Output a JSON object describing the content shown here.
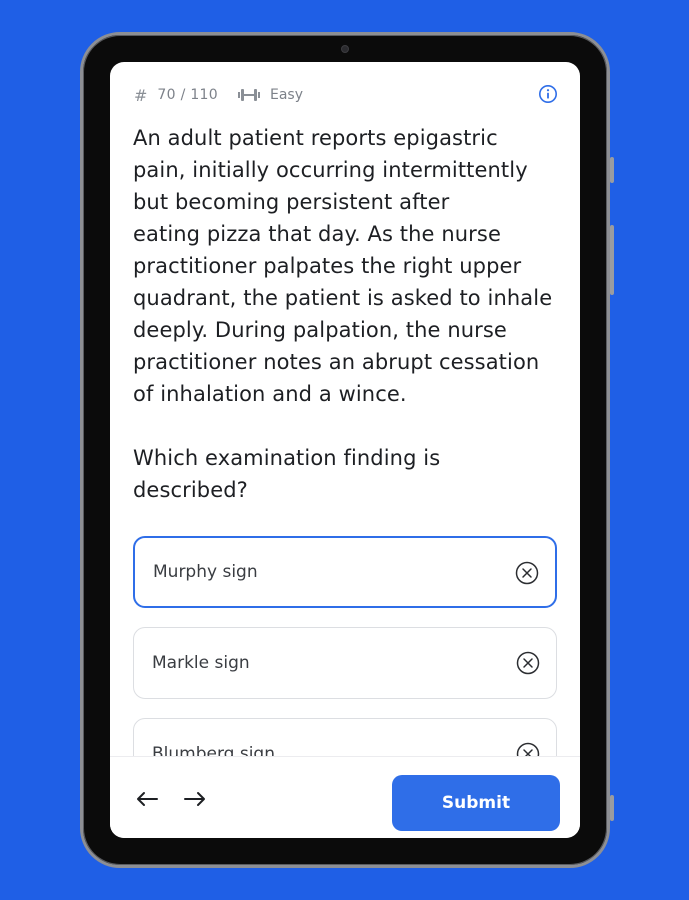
{
  "header": {
    "question_count": "70 / 110",
    "difficulty": "Easy"
  },
  "question": {
    "text": "An adult patient reports epigastric\npain, initially occurring intermittently\nbut becoming persistent after\neating pizza that day. As the nurse\npractitioner palpates the right upper\nquadrant, the patient is asked to inhale\ndeeply. During palpation, the nurse\npractitioner notes an abrupt cessation\nof inhalation and a wince.",
    "prompt": "Which examination finding is\ndescribed?"
  },
  "options": [
    {
      "label": "Murphy sign",
      "selected": true
    },
    {
      "label": "Markle sign",
      "selected": false
    },
    {
      "label": "Blumberg sign",
      "selected": false
    }
  ],
  "footer": {
    "submit_label": "Submit"
  },
  "colors": {
    "background": "#1f5fe6",
    "accent": "#2f6ee8"
  }
}
